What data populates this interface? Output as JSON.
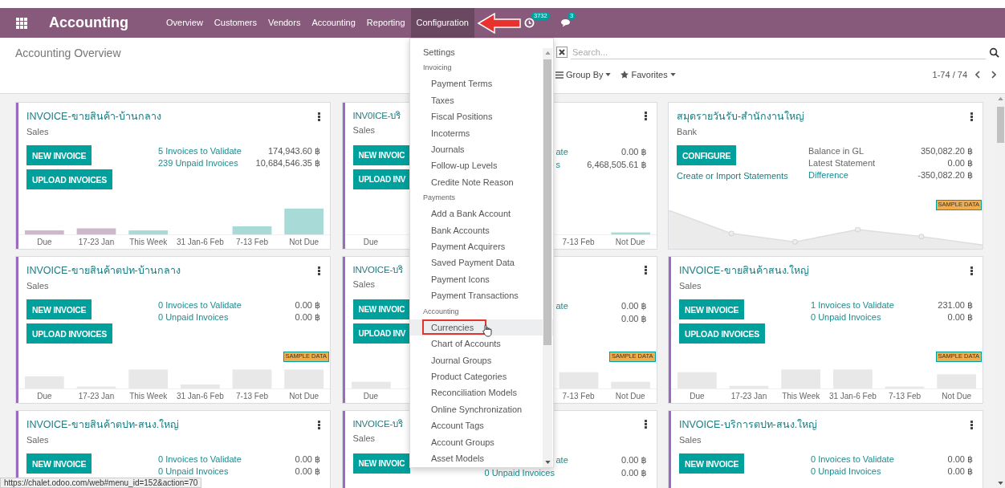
{
  "navbar": {
    "title": "Accounting",
    "menu": [
      {
        "label": "Overview",
        "selected": false
      },
      {
        "label": "Customers",
        "selected": false
      },
      {
        "label": "Vendors",
        "selected": false
      },
      {
        "label": "Accounting",
        "selected": false
      },
      {
        "label": "Reporting",
        "selected": false
      },
      {
        "label": "Configuration",
        "selected": true
      }
    ],
    "activity_badge": "3732",
    "messages_badge": "3"
  },
  "control_panel": {
    "title": "Accounting Overview",
    "search": {
      "placeholder": "Search..."
    },
    "group_by": "Group By",
    "favorites": "Favorites",
    "pager": "1-74 / 74"
  },
  "cards": [
    {
      "kind": "invoice",
      "color": "#9b6bbf",
      "title": "INVOICE-ขายสินค้า-บ้านกลาง",
      "subtitle": "Sales",
      "buttons": [
        "NEW INVOICE",
        "UPLOAD INVOICES"
      ],
      "stats": [
        {
          "label": "5 Invoices to Validate",
          "value": "174,943.60 ฿",
          "link": true
        },
        {
          "label": "239 Unpaid Invoices",
          "value": "10,684,546.35 ฿",
          "link": true
        }
      ],
      "chart": {
        "kind": "bars",
        "labels": [
          "Due",
          "17-23 Jan",
          "This Week",
          "31 Jan-6 Feb",
          "7-13 Feb",
          "Not Due"
        ]
      }
    },
    {
      "kind": "covered",
      "color": "#9b6bbf",
      "title": "INV0ICE-บริ",
      "subtitle": "Sales",
      "buttons": [
        "NEW INVOIC",
        "UPLOAD INV"
      ],
      "stats": [
        {
          "label": "ate",
          "value": "0.00 ฿",
          "link": true,
          "covered": true
        },
        {
          "label": "s",
          "value": "6,468,505.61 ฿",
          "link": true,
          "covered": true
        }
      ],
      "chart": {
        "kind": "bars",
        "labels": [
          "Due",
          "7-13 Feb",
          "Not Due"
        ]
      }
    },
    {
      "kind": "bank",
      "title": "สมุดรายวันรับ-สำนักงานใหญ่",
      "subtitle": "Bank",
      "buttons": [
        "CONFIGURE"
      ],
      "action_link": "Create or Import Statements",
      "stats": [
        {
          "label": "Balance in GL",
          "value": "350,082.20 ฿",
          "link": false
        },
        {
          "label": "Latest Statement",
          "value": "0.00 ฿",
          "link": false
        },
        {
          "label": "Difference",
          "value": "-350,082.20 ฿",
          "link": true
        }
      ],
      "chart": {
        "kind": "line",
        "badge": "SAMPLE DATA"
      }
    },
    {
      "kind": "invoice",
      "color": "#9b6bbf",
      "title": "INVOICE-ขายสินค้าตปท-บ้านกลาง",
      "subtitle": "Sales",
      "buttons": [
        "NEW INVOICE",
        "UPLOAD INVOICES"
      ],
      "stats": [
        {
          "label": "0 Invoices to Validate",
          "value": "0.00 ฿",
          "link": true
        },
        {
          "label": "0 Unpaid Invoices",
          "value": "0.00 ฿",
          "link": true
        }
      ],
      "chart": {
        "kind": "bars",
        "badge": "SAMPLE DATA",
        "labels": [
          "Due",
          "17-23 Jan",
          "This Week",
          "31 Jan-6 Feb",
          "7-13 Feb",
          "Not Due"
        ]
      }
    },
    {
      "kind": "covered",
      "color": "#9b6bbf",
      "title": "INVOICE-บริ",
      "subtitle": "Sales",
      "buttons": [
        "NEW INVOIC",
        "UPLOAD INV"
      ],
      "stats": [
        {
          "label": "ate",
          "value": "0.00 ฿",
          "link": true,
          "covered": true
        },
        {
          "value": "0.00 ฿"
        }
      ],
      "chart": {
        "kind": "bars",
        "badge": "SAMPLE DATA",
        "labels": [
          "Due",
          "7-13 Feb",
          "Not Due"
        ]
      }
    },
    {
      "kind": "invoice",
      "color": "#9b6bbf",
      "title": "INVOICE-ขายสินค้าสนง.ใหญ่",
      "subtitle": "Sales",
      "buttons": [
        "NEW INVOICE",
        "UPLOAD INVOICES"
      ],
      "stats": [
        {
          "label": "1 Invoices to Validate",
          "value": "231.00 ฿",
          "link": true
        },
        {
          "label": "0 Unpaid Invoices",
          "value": "0.00 ฿",
          "link": true
        }
      ],
      "chart": {
        "kind": "bars",
        "badge": "SAMPLE DATA",
        "labels": [
          "Due",
          "17-23 Jan",
          "This Week",
          "31 Jan-6 Feb",
          "7-13 Feb",
          "Not Due"
        ]
      }
    },
    {
      "kind": "invoice",
      "color": "#9b6bbf",
      "title": "INVOICE-ขายสินค้าตปท-สนง.ใหญ่",
      "subtitle": "Sales",
      "buttons": [
        "NEW INVOICE"
      ],
      "stats": [
        {
          "label": "0 Invoices to Validate",
          "value": "0.00 ฿",
          "link": true
        },
        {
          "label": "0 Unpaid Invoices",
          "value": "0.00 ฿",
          "link": true
        }
      ]
    },
    {
      "kind": "covered",
      "color": "#9b6bbf",
      "title": "INVOICE-บริ",
      "subtitle": "Sales",
      "buttons": [
        "NEW INVOIC"
      ],
      "stats": [
        {
          "label": "ate",
          "value": "0.00 ฿",
          "link": true,
          "covered": true
        },
        {
          "label": "0 Unpaid Invoices",
          "value": "0.00 ฿",
          "link": true
        }
      ]
    },
    {
      "kind": "invoice",
      "color": "#9b6bbf",
      "title": "INVOICE-บริการตปท-สนง.ใหญ่",
      "subtitle": "Sales",
      "buttons": [
        "NEW INVOICE"
      ],
      "stats": [
        {
          "label": "0 Invoices to Validate",
          "value": "0.00 ฿",
          "link": true
        },
        {
          "label": "0 Unpaid Invoices",
          "value": "0.00 ฿",
          "link": true
        }
      ]
    }
  ],
  "config_menu": {
    "items": [
      {
        "kind": "top",
        "label": "Settings",
        "selected": false
      },
      {
        "kind": "header",
        "label": "Invoicing"
      },
      {
        "kind": "item",
        "label": "Payment Terms",
        "selected": false
      },
      {
        "kind": "item",
        "label": "Taxes",
        "selected": false
      },
      {
        "kind": "item",
        "label": "Fiscal Positions",
        "selected": false
      },
      {
        "kind": "item",
        "label": "Incoterms",
        "selected": false
      },
      {
        "kind": "item",
        "label": "Journals",
        "selected": false
      },
      {
        "kind": "item",
        "label": "Follow-up Levels",
        "selected": false
      },
      {
        "kind": "item",
        "label": "Credite Note Reason",
        "selected": false
      },
      {
        "kind": "header",
        "label": "Payments"
      },
      {
        "kind": "item",
        "label": "Add a Bank Account",
        "selected": false
      },
      {
        "kind": "item",
        "label": "Bank Accounts",
        "selected": false
      },
      {
        "kind": "item",
        "label": "Payment Acquirers",
        "selected": false
      },
      {
        "kind": "item",
        "label": "Saved Payment Data",
        "selected": false
      },
      {
        "kind": "item",
        "label": "Payment Icons",
        "selected": false
      },
      {
        "kind": "item",
        "label": "Payment Transactions",
        "selected": false
      },
      {
        "kind": "header",
        "label": "Accounting"
      },
      {
        "kind": "item",
        "label": "Currencies",
        "selected": true
      },
      {
        "kind": "item",
        "label": "Chart of Accounts",
        "selected": false
      },
      {
        "kind": "item",
        "label": "Journal Groups",
        "selected": false
      },
      {
        "kind": "item",
        "label": "Product Categories",
        "selected": false
      },
      {
        "kind": "item",
        "label": "Reconciliation Models",
        "selected": false
      },
      {
        "kind": "item",
        "label": "Online Synchronization",
        "selected": false
      },
      {
        "kind": "item",
        "label": "Account Tags",
        "selected": false
      },
      {
        "kind": "item",
        "label": "Account Groups",
        "selected": false
      },
      {
        "kind": "item",
        "label": "Asset Models",
        "selected": false
      }
    ]
  },
  "status_url": "https://chalet.odoo.com/web#menu_id=152&action=70"
}
